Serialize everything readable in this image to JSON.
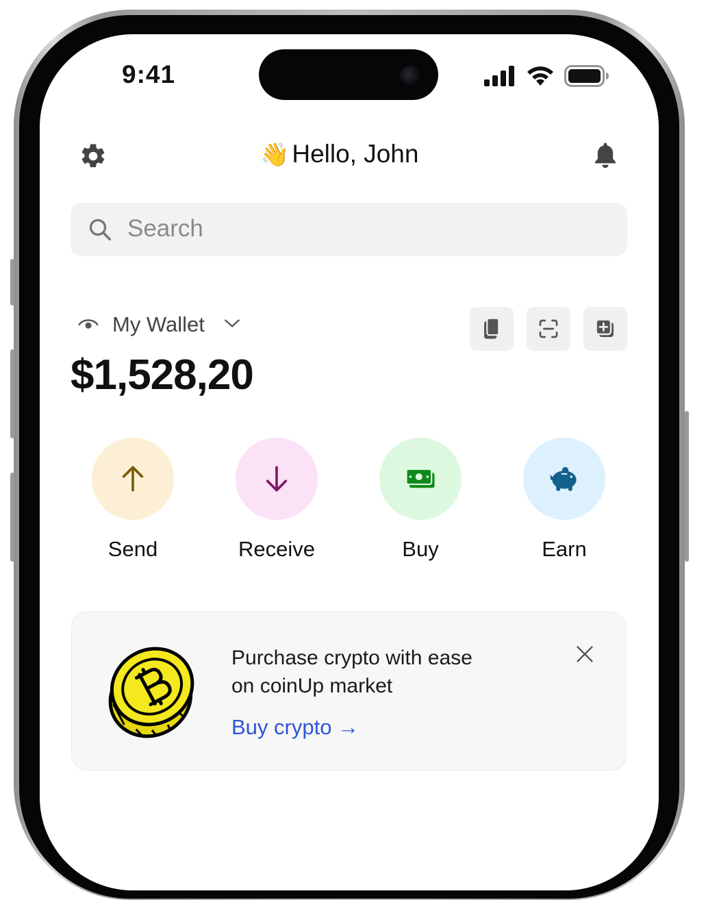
{
  "status_bar": {
    "time": "9:41"
  },
  "header": {
    "greeting_emoji": "👋",
    "greeting": "Hello, John"
  },
  "search": {
    "placeholder": "Search"
  },
  "wallet": {
    "label": "My Wallet",
    "balance": "$1,528,20"
  },
  "actions": [
    {
      "label": "Send",
      "icon": "arrow-up-icon",
      "bg": "#fdefd5",
      "color": "#7a5a0c"
    },
    {
      "label": "Receive",
      "icon": "arrow-down-icon",
      "bg": "#fce2f6",
      "color": "#7a1a6a"
    },
    {
      "label": "Buy",
      "icon": "cash-icon",
      "bg": "#dcf9df",
      "color": "#0f8a1a"
    },
    {
      "label": "Earn",
      "icon": "piggy-bank-icon",
      "bg": "#ddf0fd",
      "color": "#15618e"
    }
  ],
  "promo": {
    "line1": "Purchase crypto with ease",
    "line2": "on coinUp market",
    "link": "Buy crypto →"
  },
  "colors": {
    "link": "#2f55d4",
    "coin": "#f4e81f"
  }
}
